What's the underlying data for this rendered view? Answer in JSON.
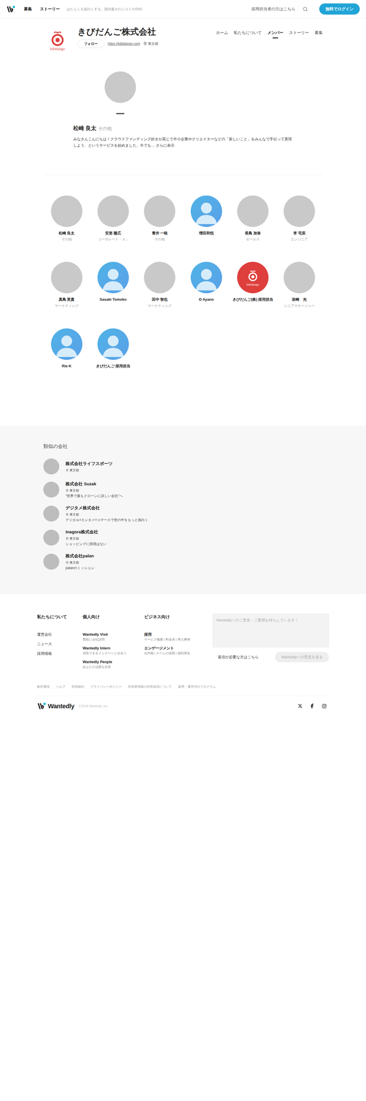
{
  "header": {
    "nav": [
      {
        "label": "募集"
      },
      {
        "label": "ストーリー"
      }
    ],
    "tagline": "はたらくを面白くする。国内最大のシゴトのSNS",
    "recruiter_link": "採用担当者の方はこちら",
    "login_button": "無料でログイン"
  },
  "company": {
    "name": "きびだんご株式会社",
    "logo_text": "kibidango",
    "follow_button": "フォロー",
    "url": "https://kibidango.com",
    "location": "東京都",
    "nav": [
      {
        "label": "ホーム",
        "selected": false
      },
      {
        "label": "私たちについて",
        "selected": false
      },
      {
        "label": "メンバー",
        "selected": true
      },
      {
        "label": "ストーリー",
        "selected": false
      },
      {
        "label": "募集",
        "selected": false
      }
    ]
  },
  "profile": {
    "name": "松崎 良太",
    "role": "その他",
    "description": "みなさんこんにちは！クラウドファンディング好きが高じて中小企業やクリエイターなどの「新しいこと」をみんなで手伝って実現しよう、というサービスを始めました。今でも…",
    "more_link": "さらに表示"
  },
  "members": [
    {
      "name": "松崎 良太",
      "role": "その他",
      "kind": "photo"
    },
    {
      "name": "安形 隆広",
      "role": "コーポレート・ス...",
      "kind": "photo"
    },
    {
      "name": "青井 一暁",
      "role": "その他",
      "kind": "photo"
    },
    {
      "name": "増田和悦",
      "role": "",
      "kind": "default"
    },
    {
      "name": "長島 加奈",
      "role": "セールス",
      "kind": "photo"
    },
    {
      "name": "李 宅辰",
      "role": "エンジニア",
      "kind": "photo"
    },
    {
      "name": "真島 英貴",
      "role": "マーケティング",
      "kind": "photo"
    },
    {
      "name": "Sasaki Tomoko",
      "role": "",
      "kind": "default"
    },
    {
      "name": "田中 智也",
      "role": "マーケティング",
      "kind": "photo"
    },
    {
      "name": "O Ayano",
      "role": "",
      "kind": "default"
    },
    {
      "name": "きびだんご(株) 採用担当",
      "role": "",
      "kind": "logo"
    },
    {
      "name": "岩崎　光",
      "role": "シニアマネージャー",
      "kind": "photo"
    },
    {
      "name": "Rie K",
      "role": "",
      "kind": "default"
    },
    {
      "name": "きびだんご 採用担当",
      "role": "",
      "kind": "default"
    }
  ],
  "similar": {
    "title": "類似の会社",
    "companies": [
      {
        "name": "株式会社ライフスポーツ",
        "location": "東京都",
        "tagline": ""
      },
      {
        "name": "株式会社 Suzak",
        "location": "東京都",
        "tagline": "\"世界で最もドローンに詳しい会社\"へ"
      },
      {
        "name": "デジタメ株式会社",
        "location": "東京都",
        "tagline": "デジタル×エンタメ×コマースで世の中をもっと面白く"
      },
      {
        "name": "Inagora株式会社",
        "location": "東京都",
        "tagline": "ショッピングに国境はない"
      },
      {
        "name": "株式会社palan",
        "location": "東京都",
        "tagline": "palanのミッション"
      }
    ]
  },
  "footer": {
    "about": {
      "title": "私たちについて",
      "links": [
        "運営会社",
        "ニュース",
        "採用情報"
      ]
    },
    "personal": {
      "title": "個人向け",
      "items": [
        {
          "name": "Wantedly Visit",
          "sub": "気軽に会社訪問"
        },
        {
          "name": "Wantedly Intern",
          "sub": "成長できるインターンと出会う"
        },
        {
          "name": "Wantedly People",
          "sub": "あなたの活躍を共有"
        }
      ]
    },
    "business": {
      "title": "ビジネス向け",
      "items": [
        {
          "name": "採用",
          "sub": "サービス概要 | 料金表 | 導入事例"
        },
        {
          "name": "エンゲージメント",
          "sub": "社内報 | チームの状態 | 福利厚生"
        }
      ]
    },
    "feedback": {
      "placeholder": "Wantedlyへのご意見・ご要望お待ちしています！",
      "reply_link": "返信が必要な方はこちら",
      "send_button": "Wantedlyへの意見を送る",
      "send_disabled": true
    },
    "links": [
      "動作環境",
      "ヘルプ",
      "利用規約",
      "プライバシーポリシー",
      "利用者情報の外部送信について",
      "販売・運営代行プログラム"
    ],
    "brand": "Wantedly",
    "copyright": "©2024 Wantedly, Inc."
  }
}
